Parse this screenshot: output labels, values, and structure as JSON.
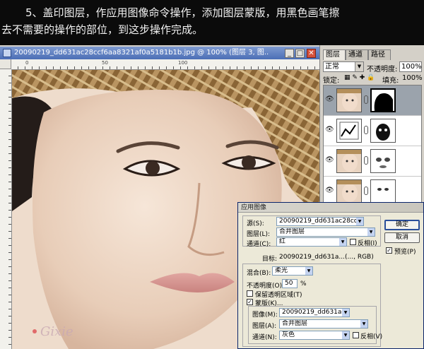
{
  "instruction": {
    "line1": "5、盖印图层，作应用图像命令操作，添加图层蒙版，用黑色画笔擦",
    "line2": "去不需要的操作的部位，到这步操作完成。"
  },
  "document": {
    "title": "20090219_dd631ac28ccf6aa8321af0a5181b1b.jpg @ 100% (图层 3, 图...",
    "minimize": "_",
    "maximize": "□",
    "close": "✕",
    "ruler_labels": [
      "0",
      "50",
      "100"
    ],
    "watermark": "Gixie"
  },
  "panels": {
    "tabs": [
      "图层",
      "通道",
      "路径"
    ],
    "blend_mode": "正常",
    "opacity_label": "不透明度:",
    "opacity_value": "100%",
    "lock_label": "锁定:",
    "fill_label": "填充:",
    "fill_value": "100%",
    "layers": [
      {
        "name": "layer-3",
        "visible": true,
        "active": true
      },
      {
        "name": "adjustment-layer",
        "visible": true,
        "active": false
      },
      {
        "name": "layer-2",
        "visible": true,
        "active": false
      },
      {
        "name": "layer-1",
        "visible": true,
        "active": false
      }
    ]
  },
  "dialog": {
    "title": "应用图像",
    "source_label": "源(S):",
    "source_value": "20090219_dd631ac28cc...",
    "layer_label": "图层(L):",
    "layer_value": "合并图层",
    "channel_label": "通道(C):",
    "channel_value": "红",
    "invert_label": "反相(I)",
    "target_label": "目标:",
    "target_value": "20090219_dd631a...(..., RGB)",
    "blending_label": "混合(B):",
    "blending_value": "柔光",
    "opacity_label": "不透明度(O):",
    "opacity_value": "50",
    "opacity_unit": "%",
    "preserve_label": "保留透明区域(T)",
    "mask_label": "蒙版(K)...",
    "image_label": "图像(M):",
    "image_value": "20090219_dd631ac28cc...",
    "mask_layer_label": "图层(A):",
    "mask_layer_value": "合并图层",
    "mask_channel_label": "通道(N):",
    "mask_channel_value": "灰色",
    "mask_invert_label": "反相(V)",
    "ok": "确定",
    "cancel": "取消",
    "preview_label": "预览(P)"
  }
}
